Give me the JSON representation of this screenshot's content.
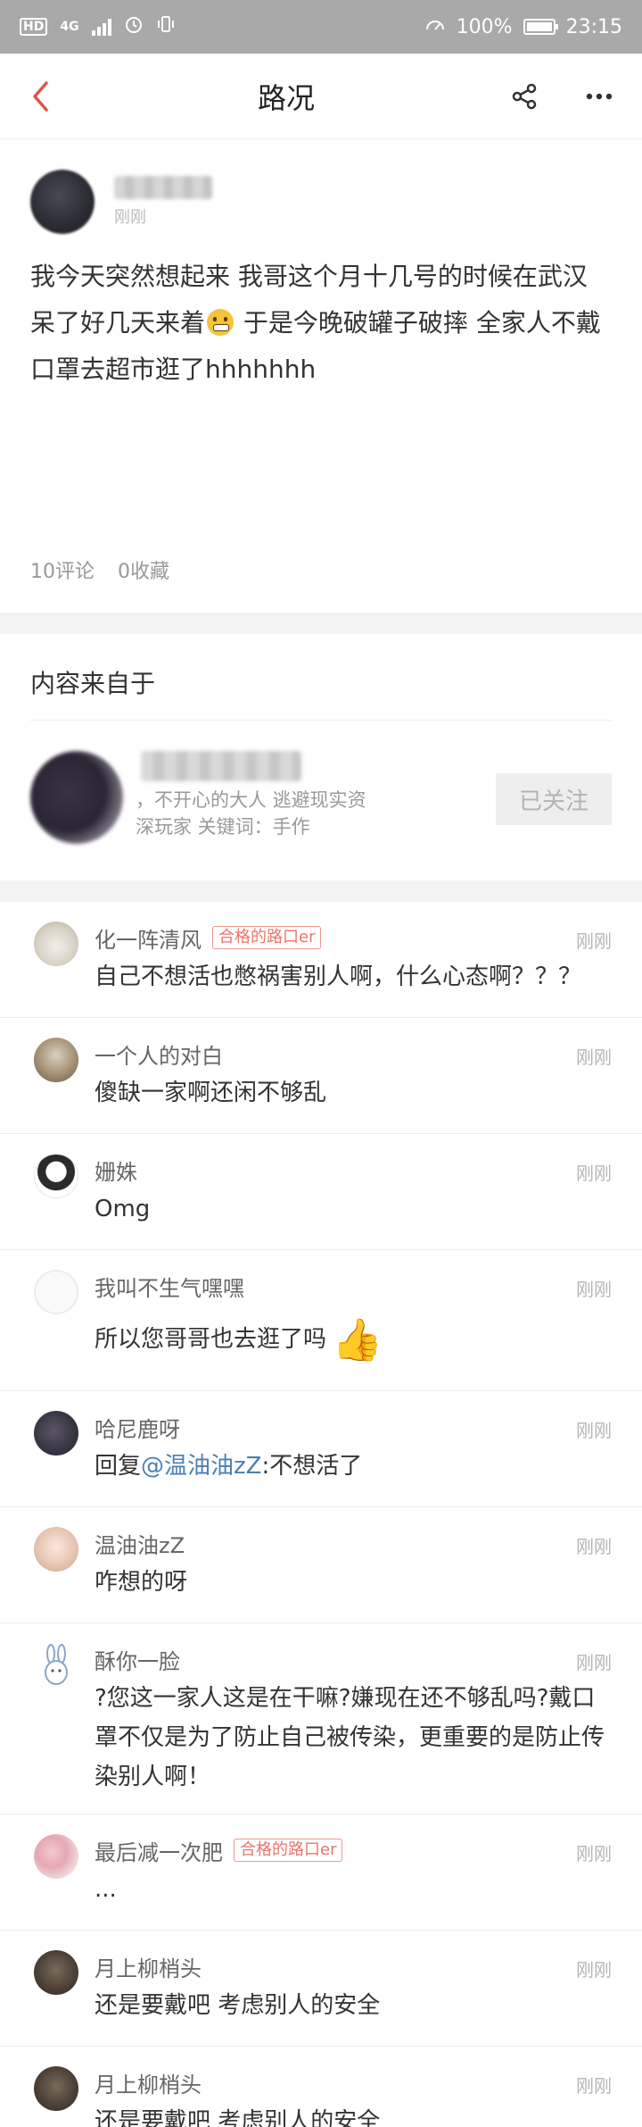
{
  "status_bar": {
    "hd": "HD",
    "network": "4G",
    "battery": "100%",
    "time": "23:15"
  },
  "nav": {
    "title": "路况",
    "icons": [
      "back-icon",
      "share-icon",
      "more-icon"
    ]
  },
  "post": {
    "time": "刚刚",
    "text_part1": "我今天突然想起来 我哥这个月十几号的时候在武汉呆了好几天来着",
    "text_part2": " 于是今晚破罐子破摔 全家人不戴口罩去超市逛了hhhhhhh",
    "comments_count": "10评论",
    "favorites_count": "0收藏"
  },
  "source": {
    "title": "内容来自于",
    "desc_line1": "，不开心的大人 逃避现实资",
    "desc_line2": "深玩家 关键词：手作",
    "follow_label": "已关注"
  },
  "comments": [
    {
      "name": "化一阵清风",
      "badge": "合格的路口er",
      "time": "刚刚",
      "text": "自己不想活也憋祸害别人啊，什么心态啊？？？"
    },
    {
      "name": "一个人的对白",
      "time": "刚刚",
      "text": "傻缺一家啊还闲不够乱"
    },
    {
      "name": "姗姝",
      "time": "刚刚",
      "text": "Omg"
    },
    {
      "name": "我叫不生气嘿嘿",
      "time": "刚刚",
      "text": "所以您哥哥也去逛了吗",
      "emoji": "👍"
    },
    {
      "name": "哈尼鹿呀",
      "time": "刚刚",
      "text_prefix": "回复",
      "mention": "@温油油zZ",
      "text_suffix": ":不想活了"
    },
    {
      "name": "温油油zZ",
      "time": "刚刚",
      "text": "咋想的呀"
    },
    {
      "name": "酥你一脸",
      "time": "刚刚",
      "text": "?您这一家人这是在干嘛?嫌现在还不够乱吗?戴口罩不仅是为了防止自己被传染，更重要的是防止传染别人啊！"
    },
    {
      "name": "最后减一次肥",
      "badge": "合格的路口er",
      "time": "刚刚",
      "text": "..."
    },
    {
      "name": "月上柳梢头",
      "time": "刚刚",
      "text": "还是要戴吧  考虑别人的安全"
    },
    {
      "name": "月上柳梢头",
      "time": "刚刚",
      "text": "还是要戴吧  考虑别人的安全"
    }
  ],
  "colors": {
    "accent_back": "#e0564a",
    "badge": "#e8756a",
    "mention": "#4a7fb8",
    "status_bar_bg": "#a9a9a9"
  }
}
